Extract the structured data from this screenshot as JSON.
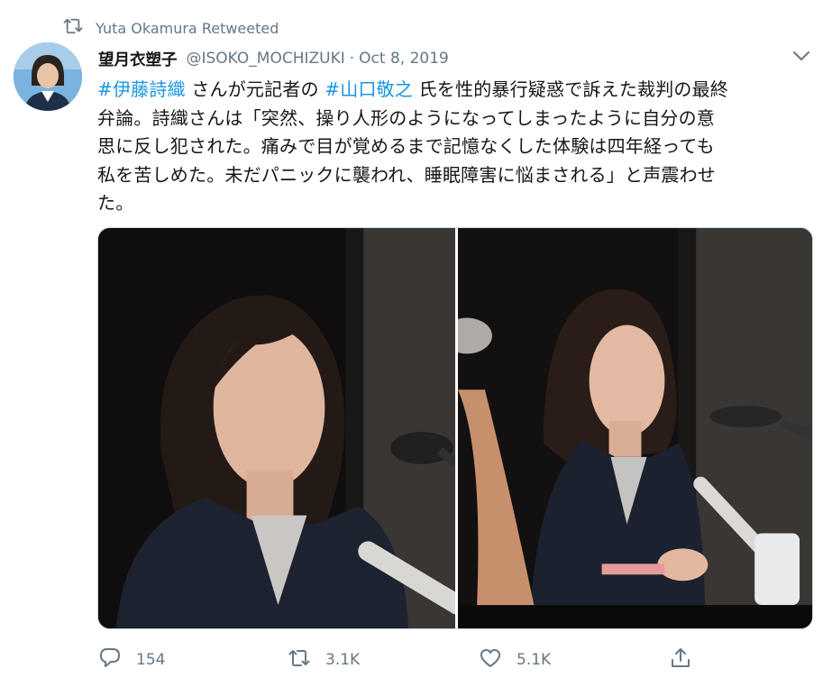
{
  "retweet_banner": {
    "text": "Yuta Okamura Retweeted"
  },
  "author": {
    "display_name": "望月衣塑子",
    "handle": "@ISOKO_MOCHIZUKI",
    "separator": "·",
    "date": "Oct 8, 2019"
  },
  "tweet": {
    "hashtag_1": "#伊藤詩織",
    "text_1": " さんが元記者の ",
    "hashtag_2": "#山口敬之",
    "text_2": " 氏を性的暴行疑惑で訴えた裁判の最終",
    "line_2": "弁論。詩織さんは「突然、操り人形のようになってしまったように自分の意",
    "line_3": "思に反し犯された。痛みで目が覚めるまで記憶なくした体験は四年経っても",
    "line_4": "私を苦しめた。未だパニックに襲われ、睡眠障害に悩まされる」と声震わせ",
    "line_5": "た。"
  },
  "actions": {
    "reply_count": "154",
    "retweet_count": "3.1K",
    "like_count": "5.1K"
  },
  "icons": {
    "retweet_banner": "retweet-icon",
    "caret": "chevron-down-icon",
    "reply": "reply-bubble-icon",
    "retweet": "retweet-icon",
    "like": "heart-icon",
    "share": "share-upload-icon"
  },
  "colors": {
    "hashtag": "#1b95e0",
    "muted_text": "#657786",
    "primary_text": "#14171a"
  }
}
